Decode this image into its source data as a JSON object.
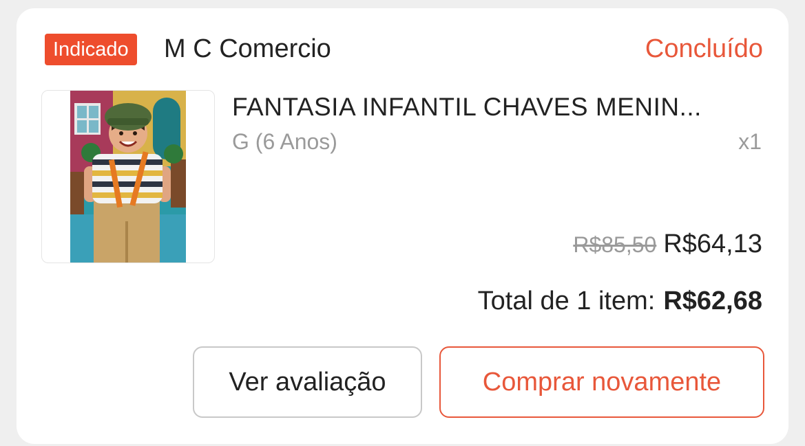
{
  "order": {
    "badge": "Indicado",
    "shop_name": "M C Comercio",
    "status": "Concluído",
    "colors": {
      "accent": "#ee4d2d",
      "status": "#e8573a",
      "muted": "#9a9a9a",
      "text": "#222222"
    }
  },
  "product": {
    "image_icon": "product-photo-costume",
    "title": "FANTASIA INFANTIL CHAVES MENIN...",
    "variant": "G (6 Anos)",
    "quantity": "x1",
    "original_price": "R$85,50",
    "price": "R$64,13"
  },
  "total": {
    "label": "Total de 1 item:",
    "value": "R$62,68"
  },
  "actions": {
    "review_label": "Ver avaliação",
    "rebuy_label": "Comprar novamente"
  }
}
